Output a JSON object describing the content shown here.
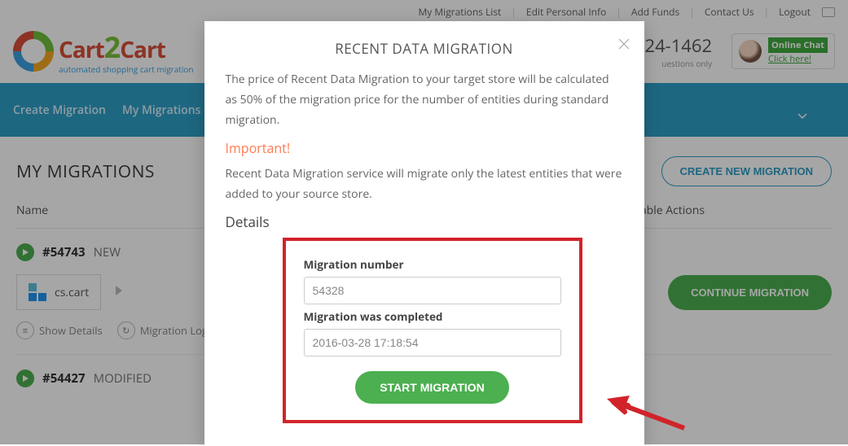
{
  "topbar": {
    "my_migrations_list": "My Migrations List",
    "edit_personal_info": "Edit Personal Info",
    "add_funds": "Add Funds",
    "contact_us": "Contact Us",
    "logout": "Logout"
  },
  "logo": {
    "brand_part1": "Cart",
    "brand_part2": "2",
    "brand_part3": "Cart",
    "tagline": "automated shopping cart migration"
  },
  "phone": {
    "number": "24-1462",
    "note": "uestions only"
  },
  "online_chat": {
    "label": "Online Chat",
    "cta": "Click here!"
  },
  "nav": {
    "create_migration": "Create Migration",
    "my_migrations": "My Migrations"
  },
  "page": {
    "title": "MY MIGRATIONS",
    "create_button": "CREATE NEW MIGRATION",
    "col_name": "Name",
    "col_actions": "ailable Actions"
  },
  "migs": [
    {
      "id": "#54743",
      "status": "NEW",
      "platform": "cs.cart",
      "action_button": "CONTINUE MIGRATION",
      "show_details": "Show Details",
      "migration_log": "Migration Log"
    },
    {
      "id": "#54427",
      "status": "MODIFIED"
    }
  ],
  "modal": {
    "title": "RECENT DATA MIGRATION",
    "intro": "The price of Recent Data Migration to your target store will be calculated as 50% of the migration price for the number of entities during standard migration.",
    "important_label": "Important!",
    "important_text": "Recent Data Migration service will migrate only the latest entities that were added to your source store.",
    "details_heading": "Details",
    "form": {
      "number_label": "Migration number",
      "number_value": "54328",
      "completed_label": "Migration was completed",
      "completed_value": "2016-03-28 17:18:54",
      "start_button": "START MIGRATION"
    }
  }
}
